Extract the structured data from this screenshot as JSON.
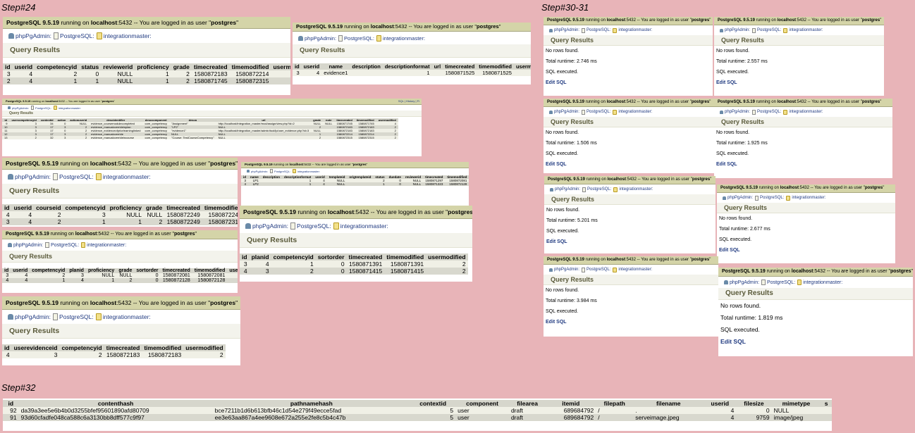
{
  "steps": {
    "s24": "Step#24",
    "s3031": "Step#30-31",
    "s32": "Step#32"
  },
  "common": {
    "pg_version": "PostgreSQL 9.5.19",
    "running_on": " running on ",
    "host": "localhost",
    "port_text": ":5432 -- You are logged in as user \"",
    "user": "postgres",
    "quote_end": "\"",
    "crumb_app": "phpPgAdmin",
    "crumb_server": "PostgreSQL",
    "crumb_db": "integrationmaster",
    "query_results": "Query Results",
    "no_rows": "No rows found.",
    "sql_executed": "SQL executed.",
    "edit_sql": "Edit SQL",
    "top_links": "SQL | History | Fi"
  },
  "left_tables": [
    {
      "headers": [
        "id",
        "userid",
        "competencyid",
        "status",
        "reviewerid",
        "proficiency",
        "grade",
        "timecreated",
        "timemodified",
        "usermodified"
      ],
      "rows": [
        [
          "3",
          "4",
          "2",
          "0",
          "NULL",
          "1",
          "2",
          "1580872183",
          "1580872214",
          "2"
        ],
        [
          "2",
          "4",
          "1",
          "1",
          "NULL",
          "1",
          "2",
          "1580871745",
          "1580872315",
          "2"
        ]
      ]
    },
    {
      "headers": [
        "id",
        "userid",
        "name",
        "description",
        "descriptionformat",
        "url",
        "timecreated",
        "timemodified",
        "usermodified"
      ],
      "rows": [
        [
          "3",
          "4",
          "evidence1",
          "",
          "1",
          "",
          "1580871525",
          "1580871525",
          "4"
        ]
      ]
    },
    {
      "headers": [
        "id",
        "usercompetencyid",
        "contextid",
        "action",
        "actionuserid",
        "descidentifier",
        "desccomponent",
        "desca",
        "url",
        "grade",
        "note",
        "timecreated",
        "timemodified",
        "usermodified"
      ],
      "rows": [
        [
          "9",
          "3",
          "34",
          "0",
          "NULL",
          "evidence_coursemodulecompleted",
          "core_competency",
          "\"Assignment\"",
          "http://localhost/integration_master/mod/assign/view.php?id=2",
          "NULL",
          "NULL",
          "1580871745",
          "1580871745",
          "4"
        ],
        [
          "10",
          "3",
          "17",
          "3",
          "2",
          "evidence_manualoverrideinplan",
          "core_competency",
          "\"LP2\"",
          "NULL",
          "2",
          "",
          "1580872183",
          "1580872183",
          "2"
        ],
        [
          "11",
          "3",
          "17",
          "0",
          "2",
          "evidence_evidenceofpriorlearninglinked",
          "core_competency",
          "\"evidence1\"",
          "http://localhost/integration_master/admin/tool/lp/user_evidence.php?id=3",
          "NULL",
          "",
          "1580872183",
          "1580872183",
          "2"
        ],
        [
          "12",
          "3",
          "17",
          "3",
          "2",
          "evidence_manualoverride",
          "core_competency",
          "NULL",
          "NULL",
          "1",
          "",
          "1580872214",
          "1580872214",
          "2"
        ],
        [
          "13",
          "2",
          "32",
          "3",
          "2",
          "evidence_manualoverrideincourse",
          "core_competency",
          "\"Course: TestCourseCompetency\"",
          "NULL",
          "2",
          "",
          "1580872315",
          "1580872315",
          "2"
        ]
      ]
    },
    {
      "headers": [
        "id",
        "userid",
        "courseid",
        "competencyid",
        "proficiency",
        "grade",
        "timecreated",
        "timemodified",
        "usermodified"
      ],
      "rows": [
        [
          "4",
          "4",
          "2",
          "3",
          "NULL",
          "NULL",
          "1580872249",
          "1580872249",
          "2"
        ],
        [
          "3",
          "4",
          "2",
          "1",
          "1",
          "2",
          "1580872249",
          "1580872315",
          "2"
        ]
      ]
    },
    {
      "headers": [
        "id",
        "name",
        "description",
        "descriptionformat",
        "userid",
        "templateid",
        "origtemplateid",
        "status",
        "duedate",
        "reviewerid",
        "timecreated",
        "timemodified",
        "usermodified"
      ],
      "rows": [
        [
          "3",
          "LP1",
          "",
          "1",
          "4",
          "NULL",
          "",
          "2",
          "0",
          "NULL",
          "1580871297",
          "1580872081",
          "2"
        ],
        [
          "4",
          "LP2",
          "",
          "1",
          "4",
          "NULL",
          "",
          "1",
          "0",
          "NULL",
          "1580871323",
          "1580872128",
          "2"
        ]
      ]
    },
    {
      "headers": [
        "id",
        "userid",
        "competencyid",
        "planid",
        "proficiency",
        "grade",
        "sortorder",
        "timecreated",
        "timemodified",
        "usermodified"
      ],
      "rows": [
        [
          "3",
          "4",
          "2",
          "3",
          "NULL",
          "NULL",
          "0",
          "1580872081",
          "1580872081",
          "2"
        ],
        [
          "4",
          "4",
          "1",
          "4",
          "1",
          "2",
          "0",
          "1580872128",
          "1580872128",
          "2"
        ]
      ]
    },
    {
      "headers": [
        "id",
        "planid",
        "competencyid",
        "sortorder",
        "timecreated",
        "timemodified",
        "usermodified"
      ],
      "rows": [
        [
          "3",
          "4",
          "1",
          "0",
          "1580871391",
          "1580871391",
          "2"
        ],
        [
          "4",
          "3",
          "2",
          "0",
          "1580871415",
          "1580871415",
          "2"
        ]
      ]
    },
    {
      "headers": [
        "id",
        "userevidenceid",
        "competencyid",
        "timecreated",
        "timemodified",
        "usermodified"
      ],
      "rows": [
        [
          "4",
          "3",
          "2",
          "1580872183",
          "1580872183",
          "2"
        ]
      ]
    }
  ],
  "runtimes": [
    "Total runtime: 2.746 ms",
    "Total runtime: 2.557 ms",
    "Total runtime: 1.506 ms",
    "Total runtime: 1.925 ms",
    "Total runtime: 5.201 ms",
    "Total runtime: 2.677 ms",
    "Total runtime: 3.984 ms",
    "Total runtime: 1.819 ms"
  ],
  "bottom_table": {
    "headers": [
      "id",
      "contenthash",
      "pathnamehash",
      "contextid",
      "component",
      "filearea",
      "itemid",
      "filepath",
      "filename",
      "userid",
      "filesize",
      "mimetype",
      "s"
    ],
    "rows": [
      [
        "92",
        "da39a3ee5e6b4b0d3255bfef95601890afd80709",
        "bce7211b1d6b613bfb46c1d54e279f49ecce5fad",
        "5",
        "user",
        "draft",
        "689684792",
        "/",
        ".",
        "4",
        "0",
        "NULL",
        ""
      ],
      [
        "91",
        "93d60cfadfe048ca588c6a3130bb8dff577c9f97",
        "ee3e63aa867a4ee9608e672a255e2fe8c5b4c47b",
        "5",
        "user",
        "draft",
        "689684792",
        "/",
        "serveimage.jpeg",
        "4",
        "9759",
        "image/jpeg",
        ""
      ]
    ]
  },
  "colors": {
    "background": "#e8b4b8",
    "topbar": "#d4d4a8",
    "link": "#203a80"
  }
}
